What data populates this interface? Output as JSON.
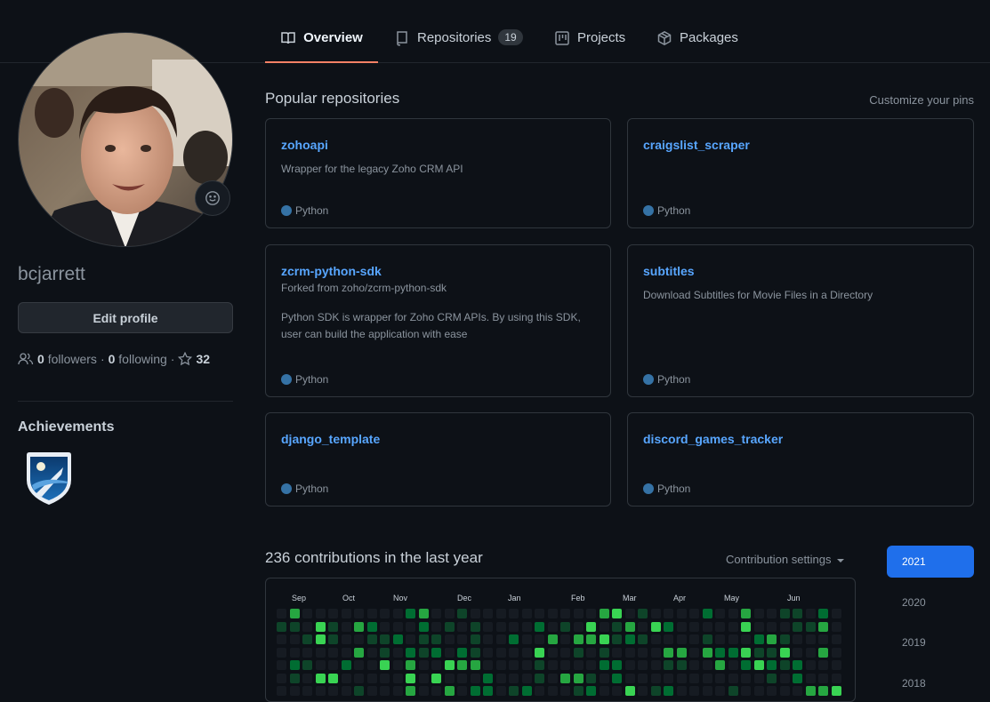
{
  "nav": {
    "tabs": [
      {
        "label": "Overview",
        "icon": "book-icon",
        "active": true
      },
      {
        "label": "Repositories",
        "icon": "repo-icon",
        "count": "19"
      },
      {
        "label": "Projects",
        "icon": "project-icon"
      },
      {
        "label": "Packages",
        "icon": "package-icon"
      }
    ]
  },
  "profile": {
    "username": "bcjarrett",
    "edit_label": "Edit profile",
    "followers_count": "0",
    "followers_label": "followers",
    "separator": "·",
    "following_count": "0",
    "following_label": "following",
    "stars_count": "32",
    "achievements_title": "Achievements"
  },
  "popular": {
    "title": "Popular repositories",
    "customize_label": "Customize your pins",
    "repos": [
      {
        "name": "zohoapi",
        "description": "Wrapper for the legacy Zoho CRM API",
        "language": "Python"
      },
      {
        "name": "craigslist_scraper",
        "description": "",
        "language": "Python"
      },
      {
        "name": "zcrm-python-sdk",
        "forked": "Forked from zoho/zcrm-python-sdk",
        "description": "Python SDK is wrapper for Zoho CRM APIs. By using this SDK, user can build the application with ease",
        "language": "Python"
      },
      {
        "name": "subtitles",
        "description": "Download Subtitles for Movie Files in a Directory",
        "language": "Python"
      },
      {
        "name": "django_template",
        "description": "",
        "language": "Python"
      },
      {
        "name": "discord_games_tracker",
        "description": "",
        "language": "Python"
      }
    ],
    "language_color": "#3572A5"
  },
  "contributions": {
    "title": "236 contributions in the last year",
    "settings_label": "Contribution settings",
    "months": [
      "Sep",
      "Oct",
      "Nov",
      "Dec",
      "Jan",
      "Feb",
      "Mar",
      "Apr",
      "May",
      "Jun"
    ],
    "level_colors": [
      "#161b22",
      "#0e4429",
      "#006d32",
      "#26a641",
      "#39d353"
    ],
    "years": [
      "2021",
      "2020",
      "2019",
      "2018"
    ],
    "active_year": "2021"
  }
}
